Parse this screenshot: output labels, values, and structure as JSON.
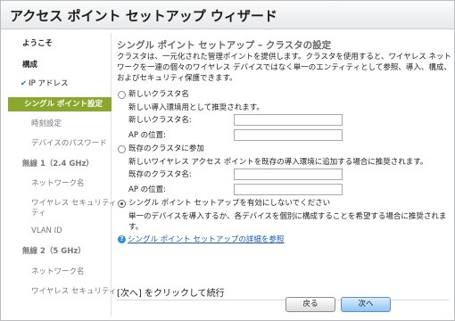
{
  "window": {
    "title": "アクセス ポイント セットアップ ウィザード"
  },
  "sidebar": {
    "items": [
      {
        "label": "ようこそ"
      },
      {
        "label": "構成"
      },
      {
        "label": "IP アドレス",
        "check": "✔"
      },
      {
        "label": "シングル ポイント設定"
      },
      {
        "label": "時刻設定"
      },
      {
        "label": "デバイスのパスワード"
      },
      {
        "label": "無線 1（2.4 GHz）"
      },
      {
        "label": "ネットワーク名"
      },
      {
        "label": "ワイヤレス セキュリティ"
      },
      {
        "label": "VLAN ID"
      },
      {
        "label": "無線 2（5 GHz）"
      },
      {
        "label": "ネットワーク名"
      },
      {
        "label": "ワイヤレス セキュリティ"
      }
    ]
  },
  "main": {
    "heading": "シングル ポイント セットアップ – クラスタの設定",
    "intro": [
      "クラスタは、一元化された管理ポイントを提供します。クラスタを使用すると、ワイヤレス ネット",
      "ワークを一連の個々のワイヤレス デバイスではなく単一のエンティティとして参照、導入、構成、",
      "およびセキュリティ保護できます。"
    ],
    "option_new": {
      "label": "新しいクラスタ名",
      "desc": "新しい導入環境用として推奨されます。",
      "cluster_name_label": "新しいクラスタ名:",
      "cluster_name_value": "",
      "ap_location_label": "AP の位置:",
      "ap_location_value": ""
    },
    "option_join": {
      "label": "既存のクラスタに参加",
      "desc": "新しいワイヤレス アクセス ポイントを既存の導入環境に追加する場合に推奨されます。",
      "cluster_name_label": "既存のクラスタ名:",
      "cluster_name_value": "",
      "ap_location_label": "AP の位置:",
      "ap_location_value": ""
    },
    "option_disable": {
      "label": "シングル ポイント セットアップを有効にしないでください",
      "desc_line1": "単一のデバイスを導入するか、各デバイスを個別に構成することを希望する場合に推奨されま",
      "desc_line2": "す。",
      "selected": true
    },
    "help_link": "シングル ポイント セットアップの詳細を参照",
    "continue_hint": "[次へ] をクリックして続行"
  },
  "buttons": {
    "back": "戻る",
    "next": "次へ"
  }
}
